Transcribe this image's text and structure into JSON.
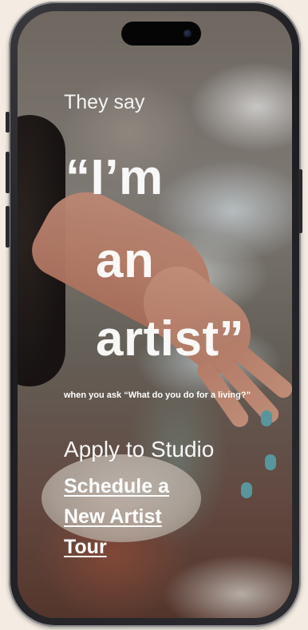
{
  "hero": {
    "intro": "They say",
    "quote_line_1": "“I’m",
    "quote_line_2": "an",
    "quote_line_3": "artist”",
    "subtitle": "when you ask “What do you do for a living?”"
  },
  "actions": {
    "apply_label": "Apply to Studio",
    "tour_line_1": "Schedule a",
    "tour_line_2": "New Artist",
    "tour_line_3": "Tour"
  },
  "colors": {
    "page_background": "#f4ece2",
    "text": "#ffffff",
    "nail_accent": "#5fa8b0"
  }
}
